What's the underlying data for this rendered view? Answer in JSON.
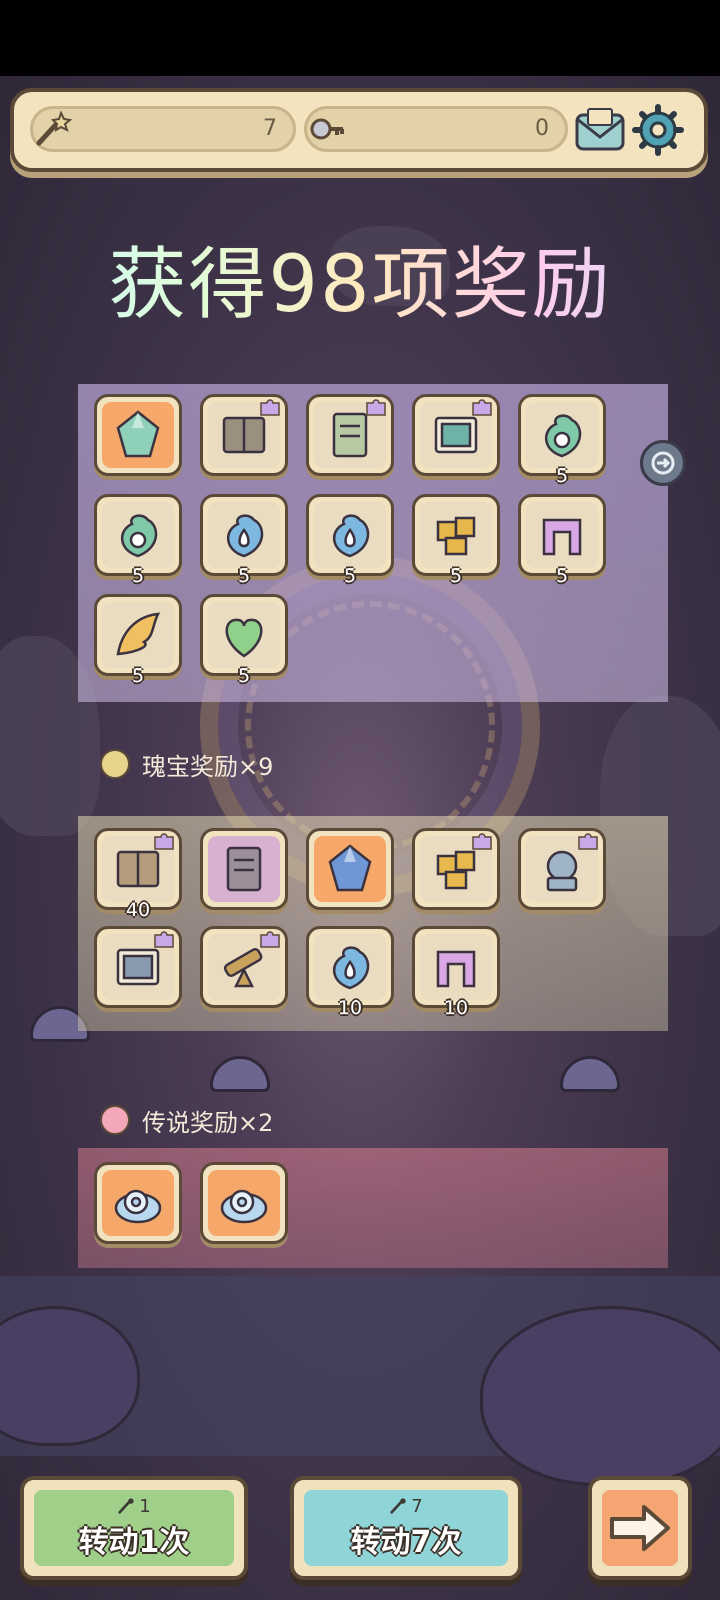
{
  "top_bar": {
    "wand_count": "7",
    "key_count": "0",
    "wand_icon": "magic-wand-icon",
    "key_icon": "key-icon",
    "mail_icon": "mail-icon",
    "settings_icon": "gear-icon"
  },
  "title": "获得98项奖励",
  "sections": {
    "treasure_label": "瑰宝奖励×9",
    "legend_label": "传说奖励×2"
  },
  "common_items": [
    {
      "icon": "crystal-cluster-icon",
      "qty": ""
    },
    {
      "icon": "open-book-icon",
      "qty": ""
    },
    {
      "icon": "scroll-map-icon",
      "qty": ""
    },
    {
      "icon": "painting-icon",
      "qty": ""
    },
    {
      "icon": "green-wisp-icon",
      "qty": "5"
    },
    {
      "icon": "green-wisp-icon",
      "qty": "5"
    },
    {
      "icon": "blue-droplet-wisp-icon",
      "qty": "5"
    },
    {
      "icon": "blue-droplet-wisp-icon",
      "qty": "5"
    },
    {
      "icon": "golden-cubes-icon",
      "qty": "5"
    },
    {
      "icon": "pink-gate-icon",
      "qty": "5"
    },
    {
      "icon": "golden-wing-icon",
      "qty": "5"
    },
    {
      "icon": "green-heart-icon",
      "qty": "5"
    }
  ],
  "treasure_items": [
    {
      "icon": "ancient-book-icon",
      "qty": "40"
    },
    {
      "icon": "old-letter-icon",
      "qty": ""
    },
    {
      "icon": "blue-gem-icon",
      "qty": ""
    },
    {
      "icon": "gold-bars-icon",
      "qty": ""
    },
    {
      "icon": "stone-lion-icon",
      "qty": ""
    },
    {
      "icon": "machine-parts-icon",
      "qty": ""
    },
    {
      "icon": "telescope-icon",
      "qty": ""
    },
    {
      "icon": "blue-droplet-wisp-icon",
      "qty": "10"
    },
    {
      "icon": "pink-gate-icon",
      "qty": "10"
    }
  ],
  "legend_items": [
    {
      "icon": "crystal-snail-icon",
      "qty": ""
    },
    {
      "icon": "crystal-snail-icon",
      "qty": ""
    }
  ],
  "buttons": {
    "spin_one_cost": "1",
    "spin_one_label": "转动1次",
    "spin_seven_cost": "7",
    "spin_seven_label": "转动7次",
    "next_icon": "arrow-right-icon"
  },
  "colors": {
    "frame": "#5b4a38",
    "parchment": "#f3e4bf",
    "green_button": "#9fcf89",
    "teal_button": "#8fd4d6",
    "orange_button": "#f4a572"
  }
}
